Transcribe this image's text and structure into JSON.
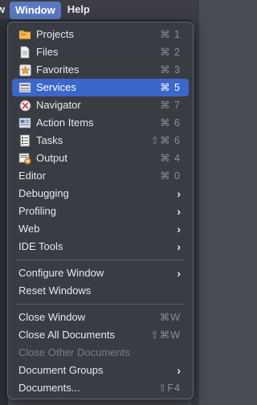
{
  "menubar": {
    "partial": "w",
    "window": "Window",
    "help": "Help"
  },
  "menu": {
    "group1": [
      {
        "label": "Projects",
        "shortcut": "⌘ 1",
        "icon": "folder-icon"
      },
      {
        "label": "Files",
        "shortcut": "⌘ 2",
        "icon": "file-icon"
      },
      {
        "label": "Favorites",
        "shortcut": "⌘ 3",
        "icon": "star-icon"
      },
      {
        "label": "Services",
        "shortcut": "⌘ 5",
        "icon": "services-icon"
      },
      {
        "label": "Navigator",
        "shortcut": "⌘ 7",
        "icon": "navigator-icon"
      },
      {
        "label": "Action Items",
        "shortcut": "⌘ 6",
        "icon": "action-items-icon"
      },
      {
        "label": "Tasks",
        "shortcut": "⇧⌘ 6",
        "icon": "tasks-icon"
      },
      {
        "label": "Output",
        "shortcut": "⌘ 4",
        "icon": "output-icon"
      }
    ],
    "editor": {
      "label": "Editor",
      "shortcut": "⌘ 0"
    },
    "submenus": [
      {
        "label": "Debugging"
      },
      {
        "label": "Profiling"
      },
      {
        "label": "Web"
      },
      {
        "label": "IDE Tools"
      }
    ],
    "configure": {
      "label": "Configure Window"
    },
    "reset": {
      "label": "Reset Windows"
    },
    "close_window": {
      "label": "Close Window",
      "shortcut": "⌘W"
    },
    "close_all": {
      "label": "Close All Documents",
      "shortcut": "⇧⌘W"
    },
    "close_other": {
      "label": "Close Other Documents"
    },
    "doc_groups": {
      "label": "Document Groups"
    },
    "documents": {
      "label": "Documents...",
      "shortcut": "⇧F4"
    },
    "selected_item": "Services"
  }
}
